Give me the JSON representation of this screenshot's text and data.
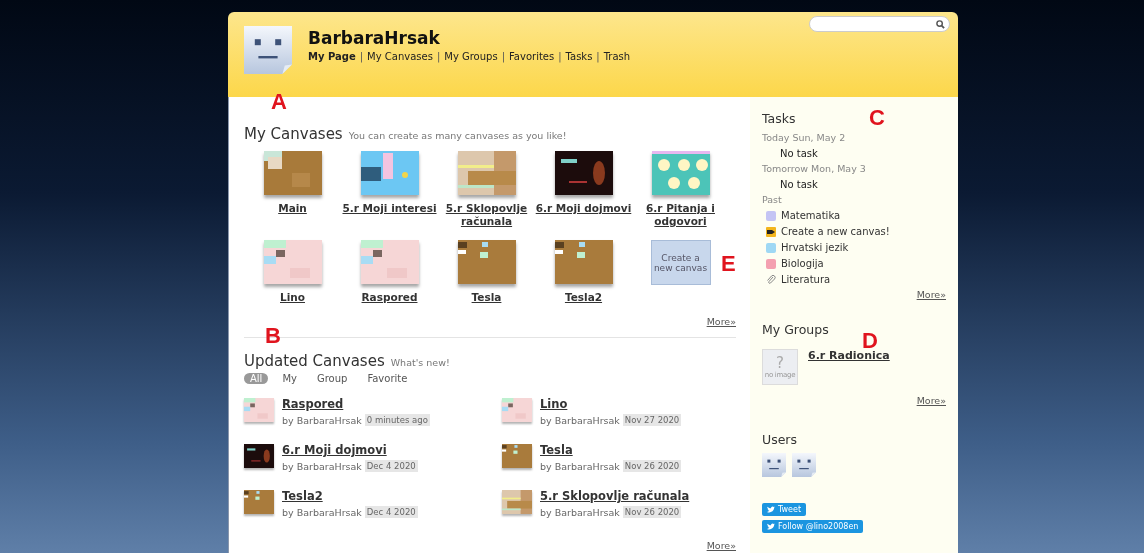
{
  "header": {
    "user_name": "BarbaraHrsak",
    "nav": [
      {
        "label": "My Page",
        "selected": true
      },
      {
        "label": "My Canvases",
        "selected": false
      },
      {
        "label": "My Groups",
        "selected": false
      },
      {
        "label": "Favorites",
        "selected": false
      },
      {
        "label": "Tasks",
        "selected": false
      },
      {
        "label": "Trash",
        "selected": false
      }
    ],
    "separator": "|",
    "has_search": true
  },
  "my_canvases": {
    "title": "My Canvases",
    "subtitle": "You can create as many canvases as you like!",
    "canvases": [
      {
        "name": "Main",
        "kind": "canvas"
      },
      {
        "name": "5.r Moji interesi",
        "kind": "canvas"
      },
      {
        "name": "5.r Sklopovlje računala",
        "kind": "canvas"
      },
      {
        "name": "6.r Moji dojmovi",
        "kind": "canvas"
      },
      {
        "name": "6.r Pitanja i odgovori",
        "kind": "canvas"
      },
      {
        "name": "Lino",
        "kind": "canvas"
      },
      {
        "name": "Raspored",
        "kind": "canvas"
      },
      {
        "name": "Tesla",
        "kind": "canvas"
      },
      {
        "name": "Tesla2",
        "kind": "canvas"
      },
      {
        "name": "Create a new canvas",
        "kind": "create"
      }
    ],
    "more": "More»"
  },
  "updated_canvases": {
    "title": "Updated Canvases",
    "subtitle": "What's new!",
    "filters": [
      {
        "label": "All",
        "selected": true
      },
      {
        "label": "My",
        "selected": false
      },
      {
        "label": "Group",
        "selected": false
      },
      {
        "label": "Favorite",
        "selected": false
      }
    ],
    "items": [
      {
        "name": "Raspored",
        "by": "by BarbaraHrsak",
        "date": "0 minutes ago"
      },
      {
        "name": "Lino",
        "by": "by BarbaraHrsak",
        "date": "Nov 27 2020"
      },
      {
        "name": "6.r Moji dojmovi",
        "by": "by BarbaraHrsak",
        "date": "Dec 4 2020"
      },
      {
        "name": "Tesla",
        "by": "by BarbaraHrsak",
        "date": "Nov 26 2020"
      },
      {
        "name": "Tesla2",
        "by": "by BarbaraHrsak",
        "date": "Dec 4 2020"
      },
      {
        "name": "5.r Sklopovlje računala",
        "by": "by BarbaraHrsak",
        "date": "Nov 26 2020"
      }
    ],
    "more": "More»"
  },
  "sidebar": {
    "tasks": {
      "title": "Tasks",
      "days": [
        {
          "label": "Today Sun, May 2",
          "entry": "No task"
        },
        {
          "label": "Tomorrow Mon, May 3",
          "entry": "No task"
        }
      ],
      "past_label": "Past",
      "past": [
        {
          "label": "Matematika",
          "kind": "swatch",
          "color": "#c4c4f4"
        },
        {
          "label": "Create a new canvas!",
          "kind": "canvas"
        },
        {
          "label": "Hrvatski jezik",
          "kind": "swatch",
          "color": "#9fd8f4"
        },
        {
          "label": "Biologija",
          "kind": "swatch",
          "color": "#f4a0b0"
        },
        {
          "label": "Literatura",
          "kind": "clip"
        }
      ],
      "more": "More»"
    },
    "groups": {
      "title": "My Groups",
      "items": [
        {
          "name": "6.r Radionica",
          "image_text": "no image",
          "mark": "?"
        }
      ],
      "more": "More»"
    },
    "users": {
      "title": "Users",
      "avatars": [
        {
          "kind": "default"
        },
        {
          "kind": "default"
        }
      ]
    },
    "social": [
      {
        "label": "Tweet"
      },
      {
        "label": "Follow @lino2008en"
      }
    ]
  },
  "annotations": [
    {
      "label": "A"
    },
    {
      "label": "B"
    },
    {
      "label": "C"
    },
    {
      "label": "D"
    },
    {
      "label": "E"
    }
  ]
}
